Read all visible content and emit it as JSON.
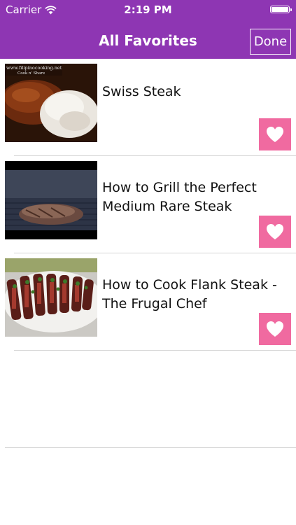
{
  "status_bar": {
    "carrier": "Carrier",
    "time": "2:19 PM",
    "wifi_icon": "wifi-icon",
    "battery_icon": "battery-icon"
  },
  "nav": {
    "title": "All Favorites",
    "done_label": "Done",
    "background_color": "#8e36b3"
  },
  "favorites": [
    {
      "title": "Swiss Steak",
      "watermark": "www.filipinocooking.net Cook n' Share",
      "favorite_icon": "heart-icon"
    },
    {
      "title": "How to Grill the Perfect Medium Rare Steak",
      "favorite_icon": "heart-icon"
    },
    {
      "title": "How to Cook Flank Steak - The Frugal Chef",
      "favorite_icon": "heart-icon"
    }
  ],
  "favorite_button_color": "#f06aa0"
}
